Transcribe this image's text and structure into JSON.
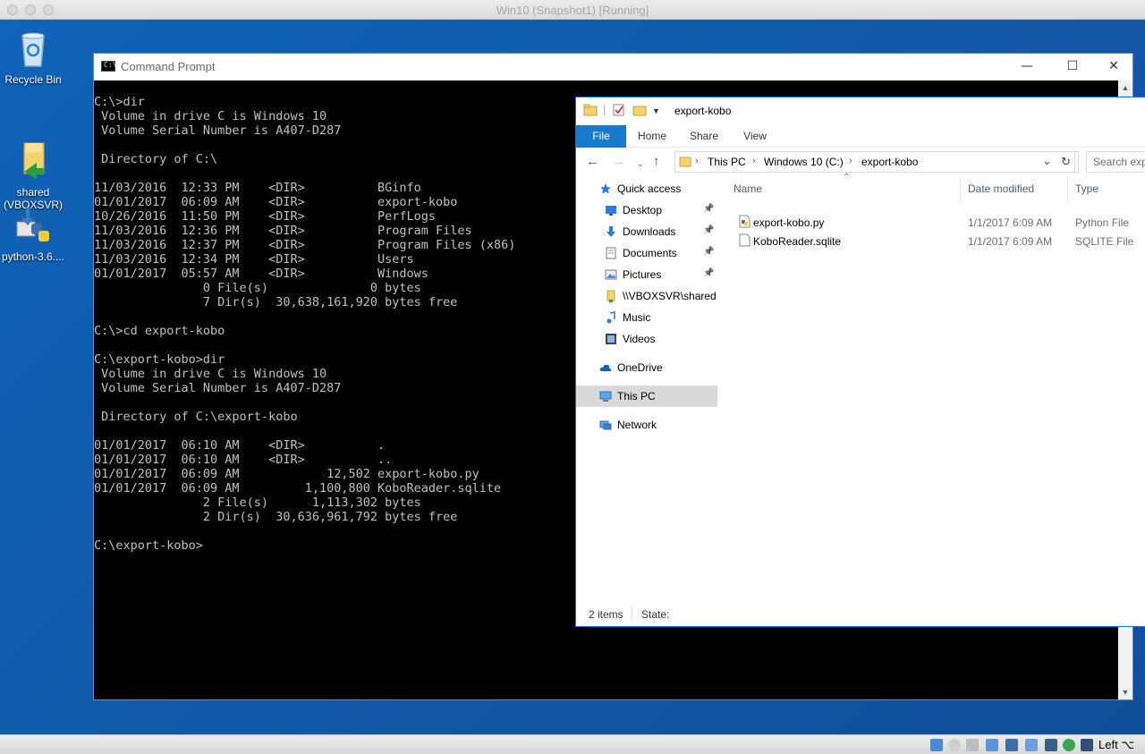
{
  "mac_window": {
    "title": "Win10 (Snapshot1) [Running]"
  },
  "desktop_icons": [
    {
      "label": "Recycle Bin"
    },
    {
      "label": "shared\n(VBOXSVR)"
    },
    {
      "label": "python-3.6...."
    }
  ],
  "cmd": {
    "title": "Command Prompt",
    "controls": {
      "minimize": "—",
      "maximize": "☐",
      "close": "✕"
    },
    "lines": [
      "C:\\>dir",
      " Volume in drive C is Windows 10",
      " Volume Serial Number is A407-D287",
      "",
      " Directory of C:\\",
      "",
      "11/03/2016  12:33 PM    <DIR>          BGinfo",
      "01/01/2017  06:09 AM    <DIR>          export-kobo",
      "10/26/2016  11:50 PM    <DIR>          PerfLogs",
      "11/03/2016  12:36 PM    <DIR>          Program Files",
      "11/03/2016  12:37 PM    <DIR>          Program Files (x86)",
      "11/03/2016  12:34 PM    <DIR>          Users",
      "01/01/2017  05:57 AM    <DIR>          Windows",
      "               0 File(s)              0 bytes",
      "               7 Dir(s)  30,638,161,920 bytes free",
      "",
      "C:\\>cd export-kobo",
      "",
      "C:\\export-kobo>dir",
      " Volume in drive C is Windows 10",
      " Volume Serial Number is A407-D287",
      "",
      " Directory of C:\\export-kobo",
      "",
      "01/01/2017  06:10 AM    <DIR>          .",
      "01/01/2017  06:10 AM    <DIR>          ..",
      "01/01/2017  06:09 AM            12,502 export-kobo.py",
      "01/01/2017  06:09 AM         1,100,800 KoboReader.sqlite",
      "               2 File(s)      1,113,302 bytes",
      "               2 Dir(s)  30,636,961,792 bytes free",
      "",
      "C:\\export-kobo>"
    ]
  },
  "explorer": {
    "title": "export-kobo",
    "ribbon_tabs": [
      "File",
      "Home",
      "Share",
      "View"
    ],
    "address": {
      "crumbs": [
        "This PC",
        "Windows 10 (C:)",
        "export-kobo"
      ]
    },
    "search_placeholder": "Search export-kobo",
    "nav": [
      {
        "label": "Quick access",
        "icon": "star-icon",
        "pinned": false
      },
      {
        "label": "Desktop",
        "icon": "desktop-folder-icon",
        "pinned": true
      },
      {
        "label": "Downloads",
        "icon": "download-icon",
        "pinned": true
      },
      {
        "label": "Documents",
        "icon": "documents-icon",
        "pinned": true
      },
      {
        "label": "Pictures",
        "icon": "pictures-icon",
        "pinned": true
      },
      {
        "label": "\\\\VBOXSVR\\shared",
        "icon": "folder-icon",
        "pinned": false
      },
      {
        "label": "Music",
        "icon": "music-icon",
        "pinned": false
      },
      {
        "label": "Videos",
        "icon": "videos-icon",
        "pinned": false
      },
      {
        "label": "OneDrive",
        "icon": "cloud-icon",
        "pinned": false
      },
      {
        "label": "This PC",
        "icon": "computer-icon",
        "pinned": false
      },
      {
        "label": "Network",
        "icon": "network-icon",
        "pinned": false
      }
    ],
    "columns": [
      "Name",
      "Date modified",
      "Type"
    ],
    "files": [
      {
        "name": "export-kobo.py",
        "modified": "1/1/2017 6:09 AM",
        "type": "Python File"
      },
      {
        "name": "KoboReader.sqlite",
        "modified": "1/1/2017 6:09 AM",
        "type": "SQLITE File"
      }
    ],
    "status": {
      "count": "2 items",
      "state_label": "State:"
    }
  },
  "vbox_bar": {
    "host_key": "Left ⌥"
  },
  "colors": {
    "accent": "#1979ca",
    "desktop": "#1356a4",
    "console_text": "#c0c0c0"
  }
}
